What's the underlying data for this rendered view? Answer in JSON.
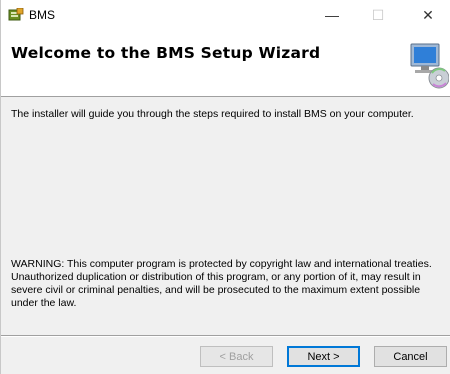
{
  "window": {
    "title": "BMS",
    "controls": {
      "minimize": "—",
      "maximize": "☐",
      "close": "✕"
    }
  },
  "banner": {
    "title": "Welcome to the BMS Setup Wizard"
  },
  "content": {
    "intro": "The installer will guide you through the steps required to install BMS on your computer.",
    "warning": "WARNING: This computer program is protected by copyright law and international treaties. Unauthorized duplication or distribution of this program, or any portion of it, may result in severe civil or criminal penalties, and will be prosecuted to the maximum extent possible under the law."
  },
  "buttons": {
    "back": "< Back",
    "next": "Next >",
    "cancel": "Cancel"
  },
  "colors": {
    "accent": "#0078d7",
    "dialog_bg": "#f0f0f0"
  }
}
